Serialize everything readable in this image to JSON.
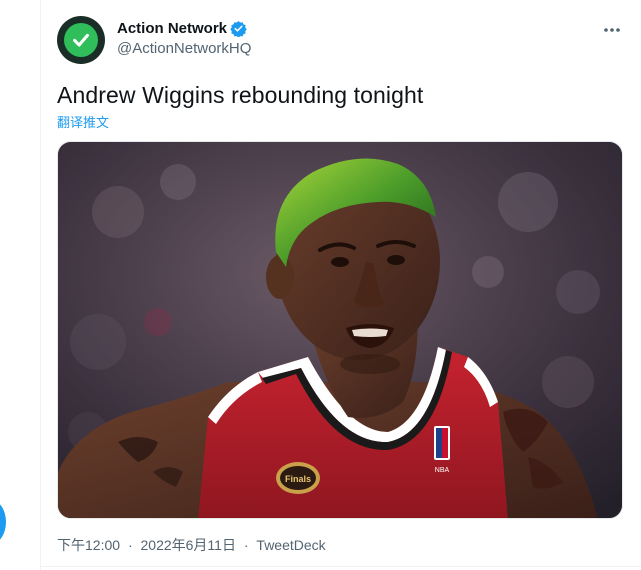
{
  "tweet": {
    "author": {
      "name": "Action Network",
      "handle": "@ActionNetworkHQ",
      "verified": true,
      "avatar_icon": "check-mark-icon"
    },
    "text": "Andrew Wiggins rebounding tonight",
    "translate_label": "翻译推文",
    "media": {
      "logo_text": "NBA",
      "patch_text": "Finals"
    },
    "time": "下午12:00",
    "separator": "·",
    "date": "2022年6月11日",
    "source": "TweetDeck"
  },
  "colors": {
    "accent": "#1d9bf0",
    "text_primary": "#0f1419",
    "text_secondary": "#536471",
    "avatar_bg": "#1a2e27",
    "avatar_green": "#2fbe5a"
  }
}
